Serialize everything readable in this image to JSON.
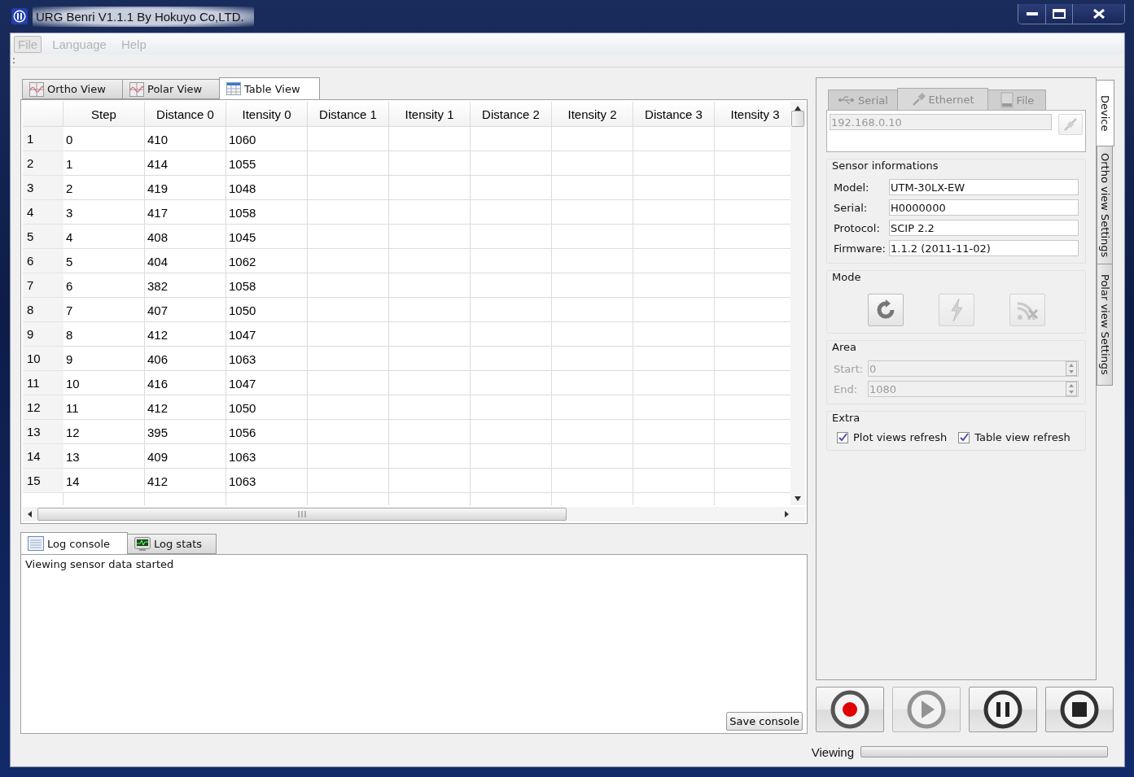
{
  "window": {
    "title": "URG Benri V1.1.1 By Hokuyo Co,LTD."
  },
  "menu": [
    {
      "label": "File",
      "selected": true
    },
    {
      "label": "Language",
      "selected": false
    },
    {
      "label": "Help",
      "selected": false
    }
  ],
  "view_tabs": [
    {
      "label": "Ortho View",
      "kind": "plot",
      "selected": false
    },
    {
      "label": "Polar View",
      "kind": "plot",
      "selected": false
    },
    {
      "label": "Table View",
      "kind": "table",
      "selected": true
    }
  ],
  "table": {
    "columns": [
      "Step",
      "Distance 0",
      "Itensity 0",
      "Distance 1",
      "Itensity 1",
      "Distance 2",
      "Itensity 2",
      "Distance 3",
      "Itensity 3"
    ],
    "rows": [
      {
        "header": "1",
        "cells": [
          "0",
          "410",
          "1060"
        ]
      },
      {
        "header": "2",
        "cells": [
          "1",
          "414",
          "1055"
        ]
      },
      {
        "header": "3",
        "cells": [
          "2",
          "419",
          "1048"
        ]
      },
      {
        "header": "4",
        "cells": [
          "3",
          "417",
          "1058"
        ]
      },
      {
        "header": "5",
        "cells": [
          "4",
          "408",
          "1045"
        ]
      },
      {
        "header": "6",
        "cells": [
          "5",
          "404",
          "1062"
        ]
      },
      {
        "header": "7",
        "cells": [
          "6",
          "382",
          "1058"
        ]
      },
      {
        "header": "8",
        "cells": [
          "7",
          "407",
          "1050"
        ]
      },
      {
        "header": "9",
        "cells": [
          "8",
          "412",
          "1047"
        ]
      },
      {
        "header": "10",
        "cells": [
          "9",
          "406",
          "1063"
        ]
      },
      {
        "header": "11",
        "cells": [
          "10",
          "416",
          "1047"
        ]
      },
      {
        "header": "12",
        "cells": [
          "11",
          "412",
          "1050"
        ]
      },
      {
        "header": "13",
        "cells": [
          "12",
          "395",
          "1056"
        ]
      },
      {
        "header": "14",
        "cells": [
          "13",
          "409",
          "1063"
        ]
      },
      {
        "header": "15",
        "cells": [
          "14",
          "412",
          "1063"
        ]
      }
    ]
  },
  "log_tabs": [
    {
      "label": "Log console",
      "kind": "console",
      "selected": true
    },
    {
      "label": "Log stats",
      "kind": "stats",
      "selected": false
    }
  ],
  "log": {
    "lines": [
      "Viewing sensor data started"
    ]
  },
  "save_button": "Save console",
  "connection_tabs": [
    {
      "label": "Serial",
      "kind": "usb",
      "selected": false
    },
    {
      "label": "Ethernet",
      "kind": "plug",
      "selected": true
    },
    {
      "label": "File",
      "kind": "file",
      "selected": false
    }
  ],
  "address": {
    "value": "192.168.0.10",
    "disabled": true
  },
  "sensor_info": {
    "title": "Sensor informations",
    "fields": [
      {
        "label": "Model:",
        "value": "UTM-30LX-EW"
      },
      {
        "label": "Serial:",
        "value": "H0000000"
      },
      {
        "label": "Protocol:",
        "value": "SCIP 2.2"
      },
      {
        "label": "Firmware:",
        "value": "1.1.2 (2011-11-02)"
      }
    ]
  },
  "mode": {
    "title": "Mode",
    "buttons": [
      {
        "kind": "refresh",
        "disabled": false
      },
      {
        "kind": "flash",
        "disabled": true
      },
      {
        "kind": "no-signal",
        "disabled": true
      }
    ]
  },
  "area": {
    "title": "Area",
    "disabled": true,
    "fields": [
      {
        "label": "Start:",
        "value": "0"
      },
      {
        "label": "End:",
        "value": "1080"
      }
    ]
  },
  "extra": {
    "title": "Extra",
    "options": [
      {
        "label": "Plot views refresh",
        "checked": true
      },
      {
        "label": "Table view refresh",
        "checked": true
      }
    ]
  },
  "side_tabs": [
    {
      "label": "Device",
      "selected": true
    },
    {
      "label": "Ortho view Settings",
      "selected": false
    },
    {
      "label": "Polar view Settings",
      "selected": false
    }
  ],
  "controls": [
    {
      "kind": "record",
      "disabled": false
    },
    {
      "kind": "play",
      "disabled": true
    },
    {
      "kind": "pause",
      "disabled": false
    },
    {
      "kind": "stop",
      "disabled": false
    }
  ],
  "status": {
    "label": "Viewing",
    "level": 0
  }
}
